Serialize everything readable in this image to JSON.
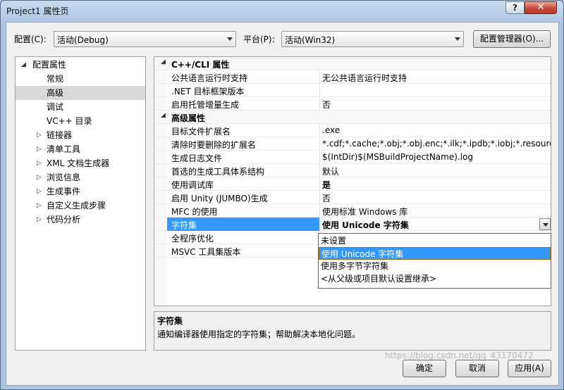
{
  "window": {
    "title": "Project1 属性页",
    "help_glyph": "?",
    "close_glyph": "✕"
  },
  "toolbar": {
    "config_label": "配置(C):",
    "config_value": "活动(Debug)",
    "platform_label": "平台(P):",
    "platform_value": "活动(Win32)",
    "config_manager_label": "配置管理器(O)..."
  },
  "tree": {
    "root": "配置属性",
    "items": [
      {
        "label": "常规",
        "expandable": false
      },
      {
        "label": "高级",
        "expandable": false,
        "selected": true
      },
      {
        "label": "调试",
        "expandable": false
      },
      {
        "label": "VC++ 目录",
        "expandable": false
      },
      {
        "label": "链接器",
        "expandable": true
      },
      {
        "label": "清单工具",
        "expandable": true
      },
      {
        "label": "XML 文档生成器",
        "expandable": true
      },
      {
        "label": "浏览信息",
        "expandable": true
      },
      {
        "label": "生成事件",
        "expandable": true
      },
      {
        "label": "自定义生成步骤",
        "expandable": true
      },
      {
        "label": "代码分析",
        "expandable": true
      }
    ]
  },
  "grid": {
    "rows": [
      {
        "type": "category",
        "name": "C++/CLI 属性"
      },
      {
        "name": "公共语言运行时支持",
        "value": "无公共语言运行时支持"
      },
      {
        "name": ".NET 目标框架版本",
        "value": ""
      },
      {
        "name": "启用托管增量生成",
        "value": "否"
      },
      {
        "type": "category",
        "name": "高级属性"
      },
      {
        "name": "目标文件扩展名",
        "value": ".exe"
      },
      {
        "name": "清除时要删除的扩展名",
        "value": "*.cdf;*.cache;*.obj;*.obj.enc;*.ilk;*.ipdb;*.iobj;*.resources;*"
      },
      {
        "name": "生成日志文件",
        "value": "$(IntDir)$(MSBuildProjectName).log"
      },
      {
        "name": "首选的生成工具体系结构",
        "value": "默认"
      },
      {
        "name": "使用调试库",
        "value": "是",
        "bold": true
      },
      {
        "name": "启用 Unity (JUMBO)生成",
        "value": "否"
      },
      {
        "name": "MFC 的使用",
        "value": "使用标准 Windows 库"
      },
      {
        "name": "字符集",
        "value": "使用 Unicode 字符集",
        "selected": true
      },
      {
        "name": "全程序优化",
        "value": ""
      },
      {
        "name": "MSVC 工具集版本",
        "value": ""
      }
    ]
  },
  "dropdown": {
    "options": [
      "未设置",
      "使用 Unicode 字符集",
      "使用多字节字符集",
      "<从父级或项目默认设置继承>"
    ],
    "selected_index": 1
  },
  "description": {
    "title": "字符集",
    "text": "通知编译器使用指定的字符集；帮助解决本地化问题。"
  },
  "buttons": {
    "ok": "确定",
    "cancel": "取消",
    "apply": "应用(A)"
  },
  "watermark": "https://blog.csdn.net/qq_43170472"
}
